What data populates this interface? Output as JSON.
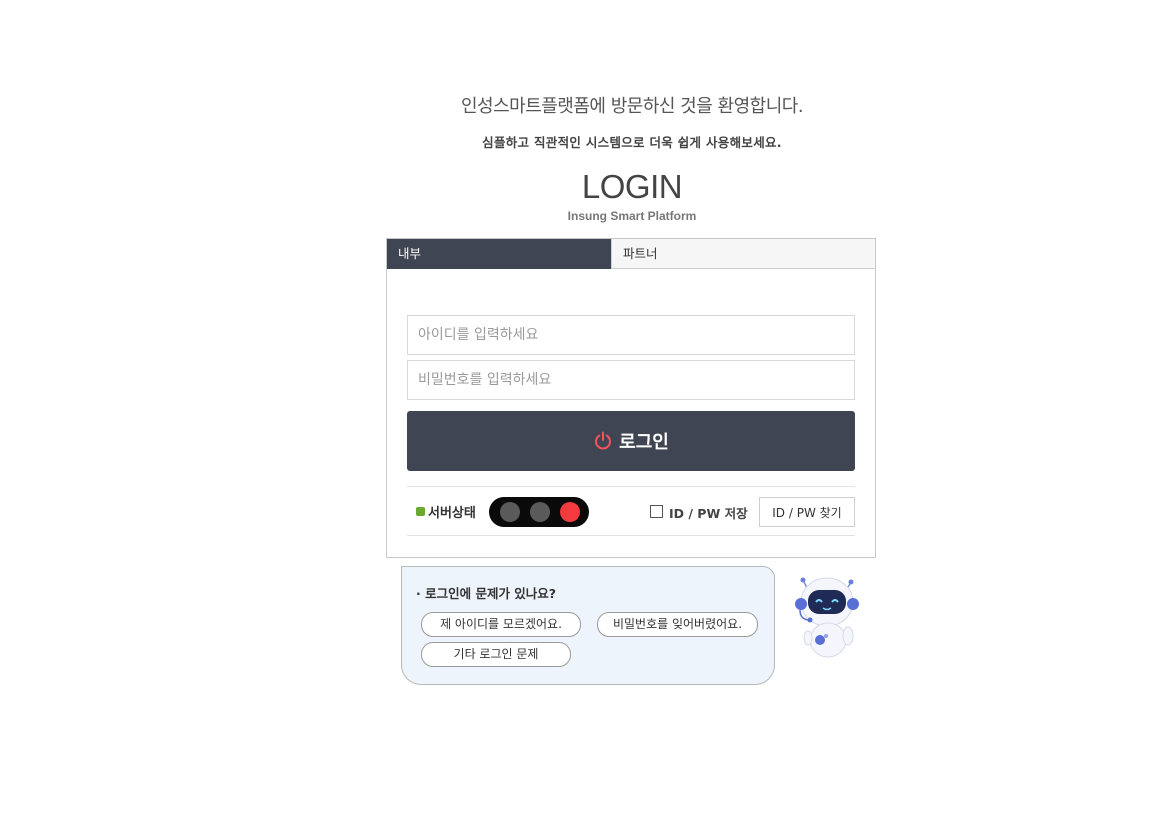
{
  "header": {
    "welcome": "인성스마트플랫폼에 방문하신 것을 환영합니다.",
    "subtitle": "심플하고 직관적인 시스템으로 더욱 쉽게 사용해보세요.",
    "login_title": "LOGIN",
    "platform_name": "Insung Smart Platform"
  },
  "tabs": [
    {
      "label": "내부",
      "active": true
    },
    {
      "label": "파트너",
      "active": false
    }
  ],
  "form": {
    "id_placeholder": "아이디를 입력하세요",
    "pw_placeholder": "비밀번호를 입력하세요",
    "login_label": "로그인"
  },
  "status": {
    "label": "서버상태",
    "lights": [
      "off",
      "off",
      "red"
    ],
    "save_label": "ID / PW 저장",
    "save_checked": false,
    "find_label": "ID / PW 찾기"
  },
  "help": {
    "title": "· 로그인에 문제가 있나요?",
    "options": [
      "제 아이디를 모르겠어요.",
      "비밀번호를 잊어버렸어요.",
      "기타 로그인 문제"
    ]
  },
  "colors": {
    "accent_dark": "#404553",
    "power_icon": "#f0555c",
    "status_red": "#f23a3f",
    "status_green_marker": "#6aa832",
    "help_bg": "#eef4fb"
  },
  "icons": {
    "login_button": "power-icon",
    "status_marker": "status-marker-icon",
    "mascot": "robot-mascot-icon"
  }
}
